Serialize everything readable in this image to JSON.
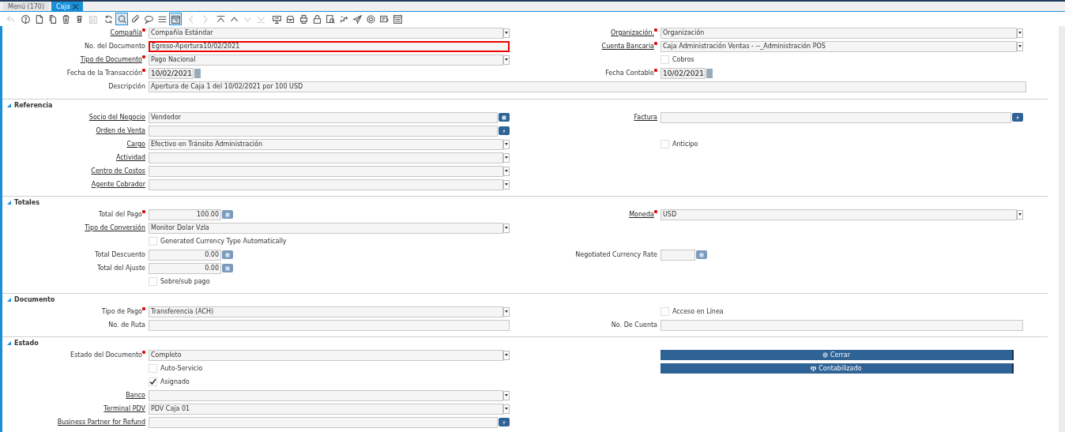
{
  "tabs": [
    {
      "label": "Menú (170)",
      "selected": false,
      "closable": false
    },
    {
      "label": "Caja",
      "selected": true,
      "closable": true
    }
  ],
  "toolbar": [
    [
      {
        "kind": "undo",
        "disabled": true,
        "selected": false
      }
    ],
    [
      {
        "kind": "help",
        "disabled": false,
        "selected": false
      },
      {
        "kind": "new",
        "disabled": false,
        "selected": false
      },
      {
        "kind": "copy",
        "disabled": false,
        "selected": false
      },
      {
        "kind": "delete",
        "disabled": false,
        "selected": false
      },
      {
        "kind": "delete-selection",
        "disabled": false,
        "selected": false
      },
      {
        "kind": "save",
        "disabled": true,
        "selected": false
      }
    ],
    [
      {
        "kind": "refresh",
        "disabled": false,
        "selected": false
      },
      {
        "kind": "find",
        "disabled": false,
        "selected": true
      },
      {
        "kind": "attachment",
        "disabled": false,
        "selected": false
      },
      {
        "kind": "chat",
        "disabled": false,
        "selected": false
      },
      {
        "kind": "grid",
        "disabled": false,
        "selected": false
      },
      {
        "kind": "calendar",
        "disabled": false,
        "selected": true
      }
    ],
    [
      {
        "kind": "previous",
        "disabled": true,
        "selected": false
      },
      {
        "kind": "next",
        "disabled": true,
        "selected": false
      }
    ],
    [
      {
        "kind": "first",
        "disabled": false,
        "selected": false
      },
      {
        "kind": "up",
        "disabled": false,
        "selected": false
      },
      {
        "kind": "down",
        "disabled": true,
        "selected": false
      },
      {
        "kind": "last",
        "disabled": true,
        "selected": false
      }
    ],
    [
      {
        "kind": "report",
        "disabled": false,
        "selected": false
      },
      {
        "kind": "archive",
        "disabled": false,
        "selected": false
      },
      {
        "kind": "print",
        "disabled": false,
        "selected": false
      },
      {
        "kind": "lock",
        "disabled": false,
        "selected": false
      },
      {
        "kind": "zoom",
        "disabled": false,
        "selected": false
      },
      {
        "kind": "workflow",
        "disabled": false,
        "selected": false
      },
      {
        "kind": "send",
        "disabled": false,
        "selected": false
      },
      {
        "kind": "process",
        "disabled": false,
        "selected": false
      },
      {
        "kind": "product",
        "disabled": false,
        "selected": false
      },
      {
        "kind": "window",
        "disabled": false,
        "selected": false
      }
    ]
  ],
  "sections": [
    {
      "rows": [
        {
          "left": {
            "label": "Compañía",
            "required": true,
            "link": true,
            "kind": "select",
            "value": "Compañía Estándar"
          },
          "right": {
            "label": "Organización.",
            "required": true,
            "link": true,
            "kind": "select",
            "value": "Organización"
          }
        },
        {
          "left": {
            "label": "No. del Documento",
            "required": false,
            "link": false,
            "kind": "text",
            "value": "Egreso-Apertura10/02/2021",
            "highlighted": true
          },
          "right": {
            "label": "Cuenta Bancaria",
            "required": true,
            "link": true,
            "kind": "select",
            "value": "Caja Administración Ventas - --_Administración POS"
          }
        },
        {
          "left": {
            "label": "Tipo de Documento",
            "required": true,
            "link": true,
            "kind": "select",
            "value": "Pago Nacional"
          },
          "right": {
            "label": "Cobros",
            "kind": "checkbox",
            "checked": false
          }
        },
        {
          "left": {
            "label": "Fecha de la Transacción",
            "required": true,
            "link": false,
            "kind": "date",
            "value": "10/02/2021"
          },
          "right": {
            "label": "Fecha Contable",
            "required": true,
            "link": false,
            "kind": "date",
            "value": "10/02/2021"
          }
        },
        {
          "full": {
            "label": "Descripción",
            "required": false,
            "link": false,
            "kind": "text",
            "value": "Apertura de Caja 1 del 10/02/2021 por 100 USD"
          }
        }
      ]
    },
    {
      "title": "Referencia",
      "expanded": true,
      "rows": [
        {
          "left": {
            "label": "Socio del Negocio",
            "required": false,
            "link": true,
            "kind": "search",
            "value": "Vendedor"
          },
          "right": {
            "label": "Factura",
            "required": false,
            "link": true,
            "kind": "zoom"
          }
        },
        {
          "left": {
            "label": "Orden de Venta",
            "required": false,
            "link": true,
            "kind": "zoom"
          }
        },
        {
          "left": {
            "label": "Cargo",
            "required": false,
            "link": true,
            "kind": "select",
            "value": "Efectivo en Tránsito Administración"
          },
          "right": {
            "label": "Anticipo",
            "kind": "checkbox",
            "checked": false
          }
        },
        {
          "left": {
            "label": "Actividad",
            "required": false,
            "link": true,
            "kind": "select"
          }
        },
        {
          "left": {
            "label": "Centro de Costos",
            "required": false,
            "link": true,
            "kind": "select"
          }
        },
        {
          "left": {
            "label": "Agente Cobrador",
            "required": false,
            "link": true,
            "kind": "select"
          }
        }
      ]
    },
    {
      "title": "Totales",
      "expanded": true,
      "rows": [
        {
          "left": {
            "label": "Total del Pago",
            "required": true,
            "link": false,
            "kind": "number",
            "value": "100.00"
          },
          "right": {
            "label": "Moneda",
            "required": true,
            "link": true,
            "kind": "select",
            "value": "USD"
          }
        },
        {
          "left": {
            "label": "Tipo de Conversión",
            "required": false,
            "link": true,
            "kind": "select",
            "value": "Monitor Dolar Vzla"
          }
        },
        {
          "left": {
            "label": "Generated Currency Type Automatically",
            "kind": "checkbox",
            "checked": false
          }
        },
        {
          "left": {
            "label": "Total Descuento",
            "required": false,
            "link": false,
            "kind": "number",
            "value": "0.00"
          },
          "right": {
            "label": "Negotiated Currency Rate",
            "required": false,
            "link": false,
            "kind": "rate"
          }
        },
        {
          "left": {
            "label": "Total del Ajuste",
            "required": false,
            "link": false,
            "kind": "number",
            "value": "0.00"
          }
        },
        {
          "left": {
            "label": "Sobre/sub pago",
            "kind": "checkbox",
            "checked": false
          }
        }
      ]
    },
    {
      "title": "Documento",
      "expanded": true,
      "rows": [
        {
          "left": {
            "label": "Tipo de Pago",
            "required": true,
            "link": false,
            "kind": "select",
            "value": "Transferencia (ACH)"
          },
          "right": {
            "label": "Acceso en Línea",
            "kind": "checkbox",
            "checked": false
          }
        },
        {
          "left": {
            "label": "No. de Ruta",
            "required": false,
            "link": false,
            "kind": "text"
          },
          "right": {
            "label": "No. De Cuenta",
            "required": false,
            "link": false,
            "kind": "text"
          }
        }
      ]
    },
    {
      "title": "Estado",
      "expanded": true,
      "rows": [
        {
          "left": {
            "label": "Estado del Documento",
            "required": true,
            "link": false,
            "kind": "select",
            "value": "Completo"
          },
          "right": {
            "label": "Cerrar",
            "kind": "button"
          }
        },
        {
          "left": {
            "label": "Auto-Servicio",
            "kind": "checkbox",
            "checked": false
          },
          "right": {
            "label": "Contabilizado",
            "kind": "button"
          }
        },
        {
          "left": {
            "label": "Asignado",
            "kind": "checkbox",
            "checked": true
          }
        },
        {
          "left": {
            "label": "Banco",
            "required": false,
            "link": true,
            "kind": "select"
          }
        },
        {
          "left": {
            "label": "Terminal PDV",
            "required": false,
            "link": true,
            "kind": "select",
            "value": "PDV Caja 01"
          }
        },
        {
          "left": {
            "label": "Business Partner for Refund",
            "required": false,
            "link": true,
            "kind": "zoom"
          }
        }
      ]
    }
  ]
}
